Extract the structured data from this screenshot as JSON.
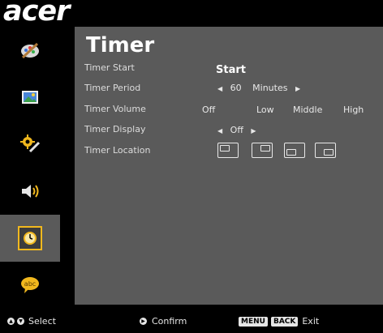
{
  "brand": {
    "logo_text": "acer"
  },
  "sidebar": {
    "items": [
      {
        "name": "color",
        "icon": "palette-brush-icon"
      },
      {
        "name": "image",
        "icon": "picture-icon"
      },
      {
        "name": "management",
        "icon": "gear-wrench-icon"
      },
      {
        "name": "audio",
        "icon": "speaker-icon"
      },
      {
        "name": "timer",
        "icon": "clock-icon",
        "active": true
      },
      {
        "name": "language",
        "icon": "speech-bubble-abc-icon"
      }
    ],
    "active_color": "#f1b81e"
  },
  "menu": {
    "title": "Timer",
    "rows": {
      "timer_start": {
        "label": "Timer Start",
        "value": "Start"
      },
      "timer_period": {
        "label": "Timer Period",
        "value": "60",
        "unit": "Minutes"
      },
      "timer_volume": {
        "label": "Timer Volume",
        "options": [
          "Off",
          "Low",
          "Middle",
          "High"
        ]
      },
      "timer_display": {
        "label": "Timer Display",
        "value": "Off"
      },
      "timer_location": {
        "label": "Timer Location",
        "options": [
          "top-left",
          "top-right",
          "bottom-left",
          "bottom-right"
        ]
      }
    }
  },
  "footer": {
    "select_label": "Select",
    "confirm_label": "Confirm",
    "menu_key": "MENU",
    "back_key": "BACK",
    "exit_label": "Exit"
  }
}
